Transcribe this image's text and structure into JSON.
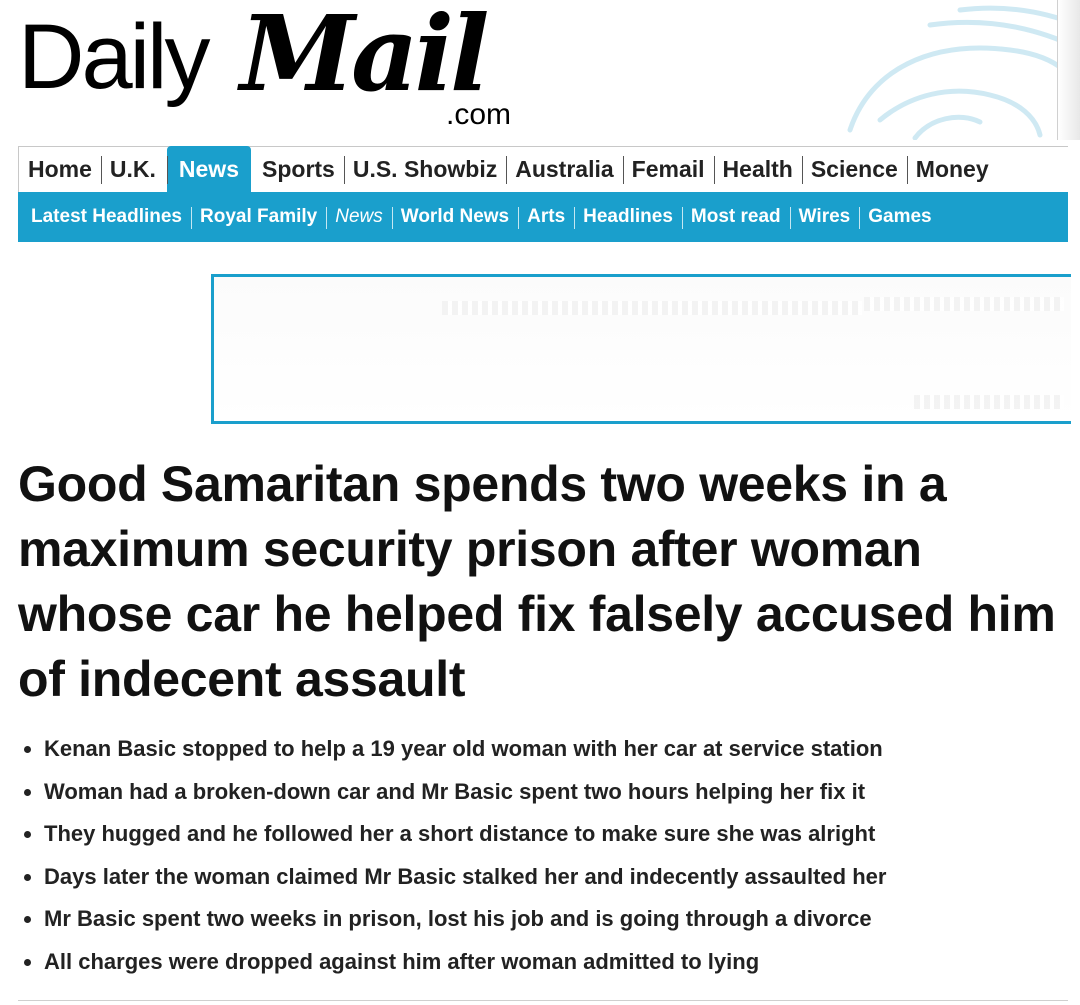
{
  "masthead": {
    "logo_daily": "Daily",
    "logo_mail": "Mail",
    "logo_com": ".com"
  },
  "primary_nav": [
    {
      "label": "Home",
      "active": false
    },
    {
      "label": "U.K.",
      "active": false
    },
    {
      "label": "News",
      "active": true
    },
    {
      "label": "Sports",
      "active": false
    },
    {
      "label": "U.S. Showbiz",
      "active": false
    },
    {
      "label": "Australia",
      "active": false
    },
    {
      "label": "Femail",
      "active": false
    },
    {
      "label": "Health",
      "active": false
    },
    {
      "label": "Science",
      "active": false
    },
    {
      "label": "Money",
      "active": false
    }
  ],
  "secondary_nav": [
    {
      "label": "Latest Headlines",
      "current": false
    },
    {
      "label": "Royal Family",
      "current": false
    },
    {
      "label": "News",
      "current": true
    },
    {
      "label": "World News",
      "current": false
    },
    {
      "label": "Arts",
      "current": false
    },
    {
      "label": "Headlines",
      "current": false
    },
    {
      "label": "Most read",
      "current": false
    },
    {
      "label": "Wires",
      "current": false
    },
    {
      "label": "Games",
      "current": false
    }
  ],
  "article": {
    "headline": "Good Samaritan spends two weeks in a maximum security prison after woman whose car he helped fix falsely accused him of indecent assault",
    "bullets": [
      "Kenan Basic stopped to help a 19 year old woman with her car at service station",
      "Woman had a broken-down car and Mr Basic spent two hours helping her fix it",
      "They hugged and he followed her a short distance to make sure she was alright",
      "Days later the woman claimed Mr Basic stalked her and indecently assaulted her",
      "Mr Basic spent two weeks in prison, lost his job and is going through a divorce",
      "All charges were dropped against him after woman admitted to lying"
    ]
  },
  "colors": {
    "accent": "#1a9fcc",
    "text": "#111111",
    "nav_text": "#222222"
  }
}
